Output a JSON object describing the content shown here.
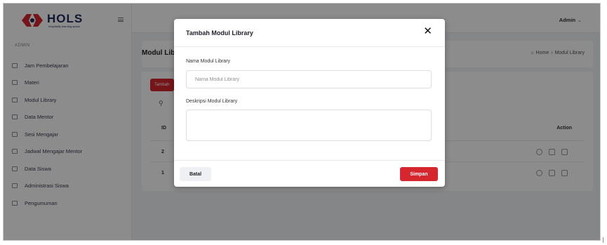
{
  "app": {
    "brand_name": "HOLS",
    "brand_tagline": "hospitality learning space",
    "brand_color": "#d6272e",
    "navy_color": "#1c2b5a"
  },
  "sidebar": {
    "section_label": "ADMIN",
    "items": [
      {
        "label": "Jam Pembelajaran",
        "icon": "square-icon"
      },
      {
        "label": "Materi",
        "icon": "square-icon"
      },
      {
        "label": "Modul Library",
        "icon": "square-icon"
      },
      {
        "label": "Data Mentor",
        "icon": "square-icon"
      },
      {
        "label": "Sesi Mengajar",
        "icon": "square-icon"
      },
      {
        "label": "Jadwal Mengajar Mentor",
        "icon": "square-icon"
      },
      {
        "label": "Data Siswa",
        "icon": "square-icon"
      },
      {
        "label": "Administrasi Siswa",
        "icon": "square-icon"
      },
      {
        "label": "Pengumuman",
        "icon": "square-icon"
      }
    ]
  },
  "header": {
    "user_label": "Admin"
  },
  "page": {
    "title": "Modul Library",
    "breadcrumb_home": "Home",
    "breadcrumb_sep": "›",
    "breadcrumb_current": "Modul Library",
    "add_button_label": "Tambah",
    "table": {
      "col_id": "ID",
      "col_action": "Action",
      "rows": [
        {
          "id": "2"
        },
        {
          "id": "1"
        }
      ]
    }
  },
  "modal": {
    "title": "Tambah Modul Library",
    "close_glyph": "✕",
    "name_label": "Nama Modul Library",
    "name_placeholder": "Nama Modul Library",
    "desc_label": "Deskripsi Modul Library",
    "desc_placeholder": "",
    "cancel_label": "Batal",
    "save_label": "Simpan"
  }
}
